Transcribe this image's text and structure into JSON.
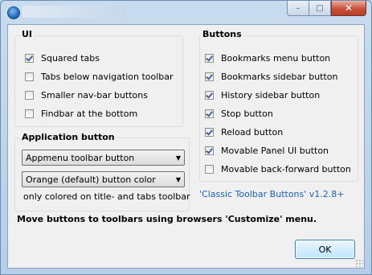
{
  "window": {
    "title": "",
    "caption_buttons": {
      "minimize": "–",
      "maximize": "□",
      "close": "✕"
    }
  },
  "ui_group": {
    "title": "UI",
    "items": [
      {
        "label": "Squared tabs",
        "checked": true
      },
      {
        "label": "Tabs below navigation toolbar",
        "checked": false
      },
      {
        "label": "Smaller nav-bar buttons",
        "checked": false
      },
      {
        "label": "Findbar at the bottom",
        "checked": false
      }
    ]
  },
  "buttons_group": {
    "title": "Buttons",
    "items": [
      {
        "label": "Bookmarks menu button",
        "checked": true
      },
      {
        "label": "Bookmarks sidebar button",
        "checked": true
      },
      {
        "label": "History sidebar button",
        "checked": true
      },
      {
        "label": "Stop button",
        "checked": true
      },
      {
        "label": "Reload button",
        "checked": true
      },
      {
        "label": "Movable Panel UI button",
        "checked": true
      },
      {
        "label": "Movable back-forward button",
        "checked": false
      }
    ]
  },
  "app_button_group": {
    "title": "Application button",
    "combo1": {
      "value": "Appmenu toolbar button"
    },
    "combo2": {
      "value": "Orange (default) button color"
    },
    "note": "only colored on title- and tabs toolbar"
  },
  "version_link": "'Classic Toolbar Buttons' v1.2.8+",
  "footer_text": "Move buttons to toolbars using browsers 'Customize' menu.",
  "ok_label": "OK",
  "icons": {
    "dropdown": "chevron-down-icon",
    "check": "checkmark-icon"
  }
}
